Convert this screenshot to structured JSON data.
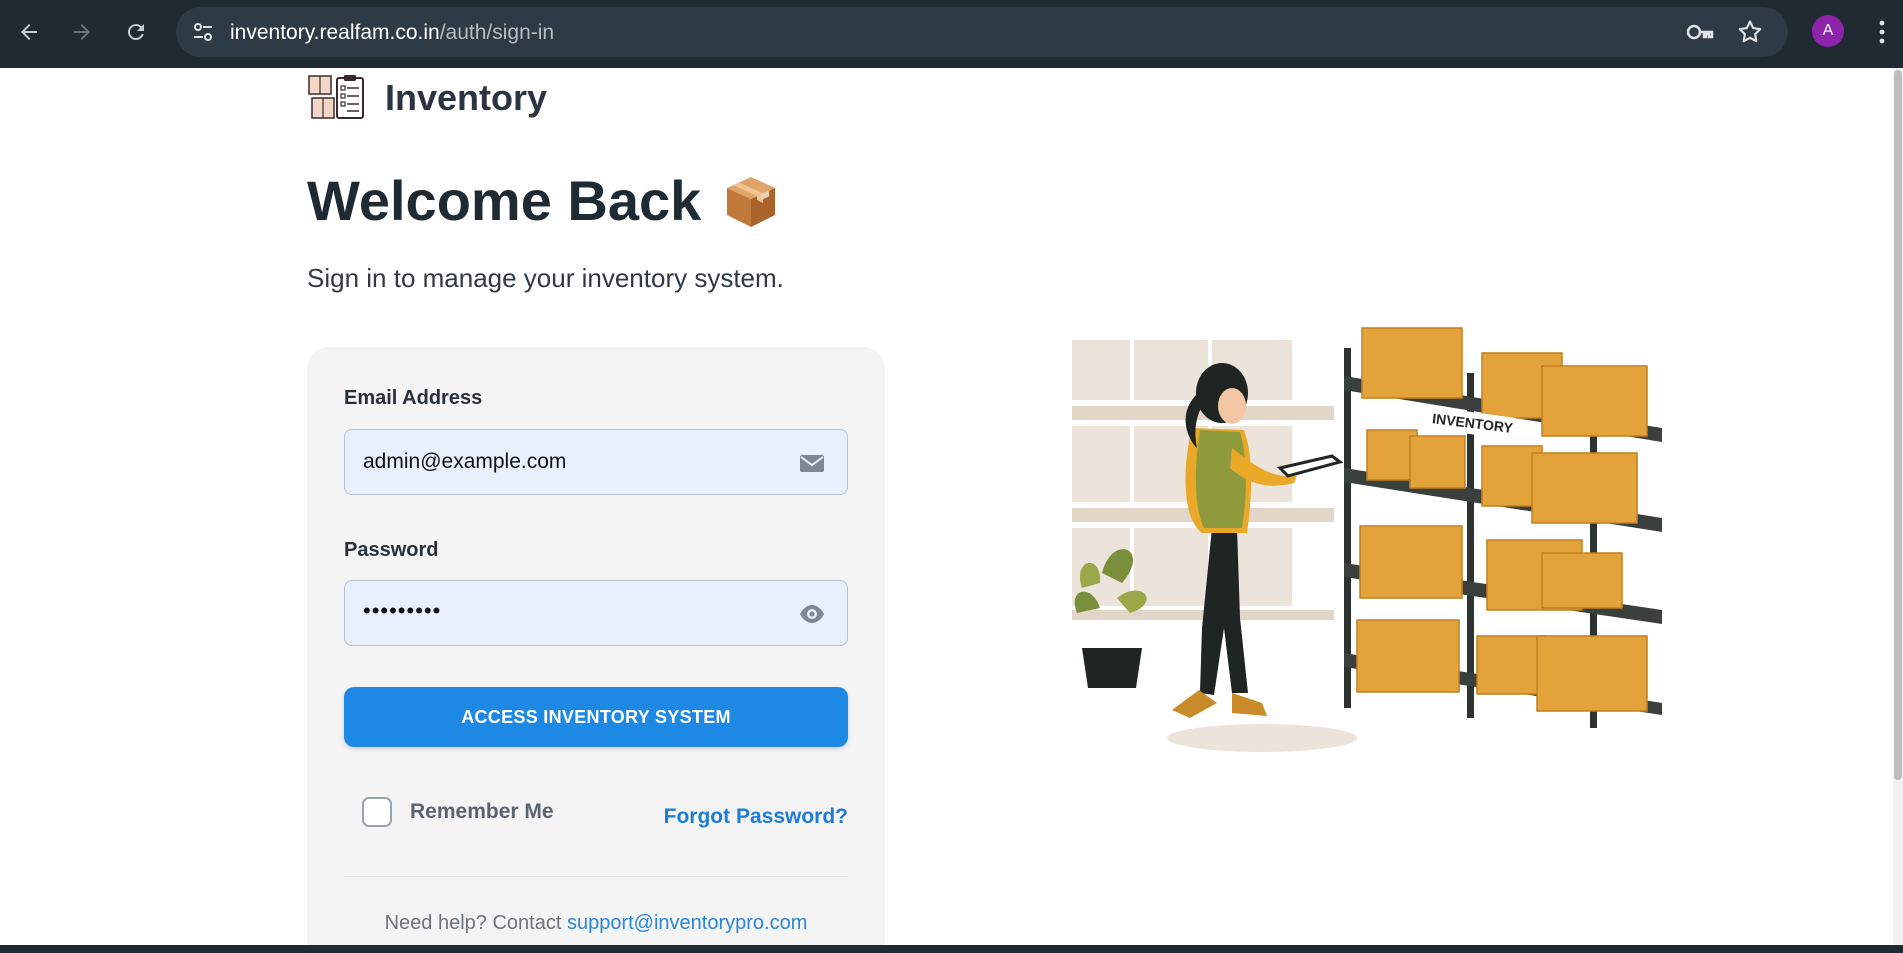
{
  "browser": {
    "url_host": "inventory.realfam.co.in",
    "url_path": "/auth/sign-in",
    "profile_initial": "A"
  },
  "brand": {
    "name": "Inventory"
  },
  "heading": {
    "title": "Welcome Back",
    "subtitle": "Sign in to manage your inventory system."
  },
  "form": {
    "email_label": "Email Address",
    "email_value": "admin@example.com",
    "password_label": "Password",
    "password_value": "•••••••••",
    "submit_label": "ACCESS INVENTORY SYSTEM",
    "remember_label": "Remember Me",
    "remember_checked": false,
    "forgot_label": "Forgot Password?",
    "help_prefix": "Need help? Contact ",
    "help_email": "support@inventorypro.com"
  },
  "illustration": {
    "shelf_label": "INVENTORY"
  },
  "colors": {
    "accent": "#1e88e5",
    "link": "#1e7dd8",
    "input_bg": "#e8f0fe",
    "card_bg": "#f4f4f4",
    "chrome_bg": "#202a33"
  }
}
